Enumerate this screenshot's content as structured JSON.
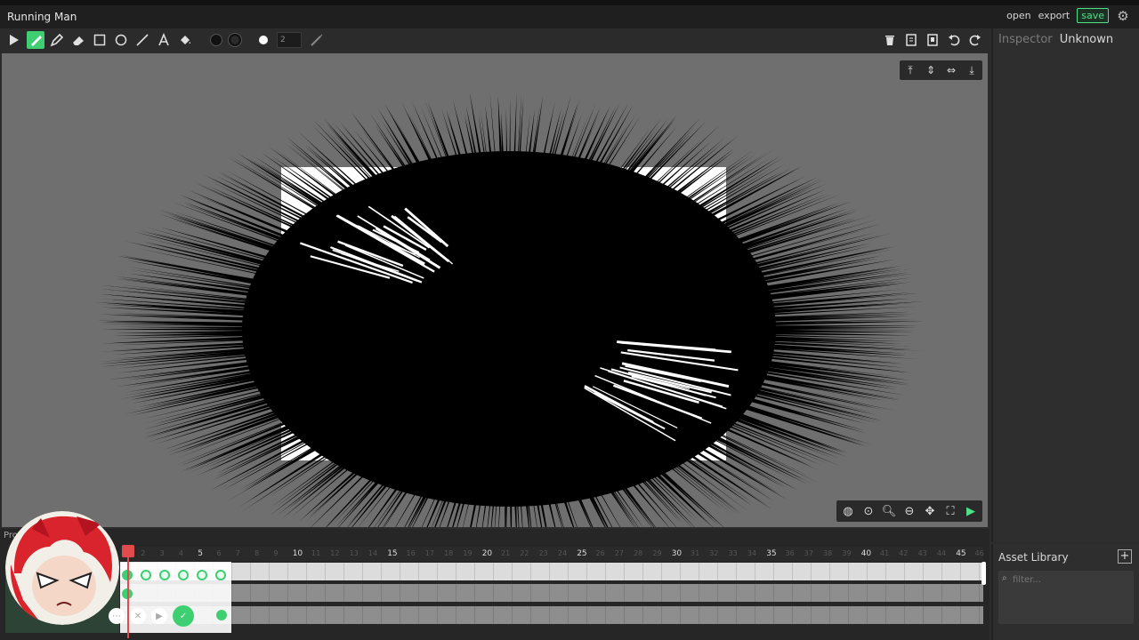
{
  "app": {
    "title": "Running Man"
  },
  "header": {
    "open_label": "open",
    "export_label": "export",
    "save_label": "save"
  },
  "toolbar": {
    "tools": [
      "select-arrow",
      "brush",
      "pencil",
      "eraser",
      "rectangle",
      "ellipse",
      "line",
      "text",
      "fill-bucket"
    ],
    "size_value": "2"
  },
  "inspector": {
    "label": "Inspector",
    "selection": "Unknown"
  },
  "timeline": {
    "panel_label": "Pro",
    "ruler_major": [
      "5",
      "10",
      "15",
      "20",
      "25",
      "30",
      "35",
      "40",
      "45"
    ],
    "current_frame": 1
  },
  "assets": {
    "title": "Asset Library",
    "filter_placeholder": "filter..."
  },
  "colors": {
    "accent": "#3fcf73",
    "playhead": "#e14b4b",
    "canvas": "#6f6f6f"
  }
}
